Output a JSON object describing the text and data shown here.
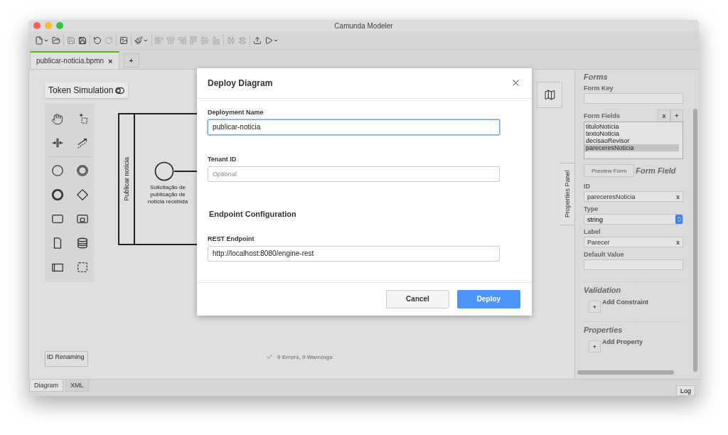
{
  "window": {
    "title": "Camunda Modeler"
  },
  "toolbar_groups": [
    [
      {
        "kind": "new",
        "disabled": false,
        "dropdown": true
      },
      {
        "kind": "open",
        "disabled": false,
        "dropdown": false
      }
    ],
    [
      {
        "kind": "save",
        "disabled": true,
        "dropdown": false
      },
      {
        "kind": "save-as",
        "disabled": false,
        "dropdown": false
      }
    ],
    [
      {
        "kind": "undo",
        "disabled": false,
        "dropdown": false
      },
      {
        "kind": "redo",
        "disabled": true,
        "dropdown": false
      }
    ],
    [
      {
        "kind": "export-image",
        "disabled": false,
        "dropdown": false
      }
    ],
    [
      {
        "kind": "color",
        "disabled": false,
        "dropdown": true
      }
    ],
    [
      {
        "kind": "align-left",
        "disabled": true,
        "dropdown": false
      },
      {
        "kind": "align-center",
        "disabled": true,
        "dropdown": false
      },
      {
        "kind": "align-right",
        "disabled": true,
        "dropdown": false
      },
      {
        "kind": "align-top",
        "disabled": true,
        "dropdown": false
      },
      {
        "kind": "align-middle",
        "disabled": true,
        "dropdown": false
      },
      {
        "kind": "align-bottom",
        "disabled": true,
        "dropdown": false
      }
    ],
    [
      {
        "kind": "distribute-horizontal",
        "disabled": true,
        "dropdown": false
      },
      {
        "kind": "distribute-vertical",
        "disabled": true,
        "dropdown": false
      }
    ],
    [
      {
        "kind": "deploy",
        "disabled": false,
        "dropdown": false
      },
      {
        "kind": "run",
        "disabled": false,
        "dropdown": true
      }
    ]
  ],
  "tabs": [
    {
      "label": "publicar-noticia.bpmn",
      "close": "×",
      "selected": true
    }
  ],
  "add_tab": "+",
  "canvas": {
    "token_simulation": "Token Simulation",
    "pool_label": "Publicar notícia",
    "start_event_label": "Solicitação de publicação de notícia recebida",
    "id_renaming": "ID Renaming",
    "status": "0 Errors, 0 Warnings"
  },
  "properties_tab": "Properties Panel",
  "properties": {
    "forms_title": "Forms",
    "form_key_label": "Form Key",
    "form_fields_label": "Form Fields",
    "remove": "x",
    "add": "+",
    "form_fields": [
      {
        "label": "tituloNoticia",
        "selected": false
      },
      {
        "label": "textoNoticia",
        "selected": false
      },
      {
        "label": "decisaoRevisor",
        "selected": false
      },
      {
        "label": "pareceresNoticia",
        "selected": true
      }
    ],
    "preview_form": "Preview Form",
    "form_field_title": "Form Field",
    "id_label": "ID",
    "id_value": "pareceresNoticia",
    "id_clear": "x",
    "type_label": "Type",
    "type_value": "string",
    "label_label": "Label",
    "label_value": "Parecer",
    "label_clear": "x",
    "default_label": "Default Value",
    "validation_title": "Validation",
    "add_constraint": "Add Constraint",
    "add_constraint_button": "+",
    "properties_title": "Properties",
    "add_property": "Add Property",
    "add_property_button": "+"
  },
  "bottom_tabs": [
    {
      "label": "Diagram",
      "selected": true
    },
    {
      "label": "XML",
      "selected": false
    }
  ],
  "log": "Log",
  "dialog": {
    "title": "Deploy Diagram",
    "fields": [
      {
        "label": "Deployment Name",
        "value": "publicar-noticia",
        "focused": true
      },
      {
        "label": "Tenant ID",
        "placeholder": "Optional",
        "focused": false
      }
    ],
    "section": "Endpoint Configuration",
    "endpoint": {
      "label": "REST Endpoint",
      "value": "http://localhost:8080/engine-rest",
      "focused": false
    },
    "buttons": [
      {
        "label": "Cancel",
        "primary": false
      },
      {
        "label": "Deploy",
        "primary": true
      }
    ]
  }
}
